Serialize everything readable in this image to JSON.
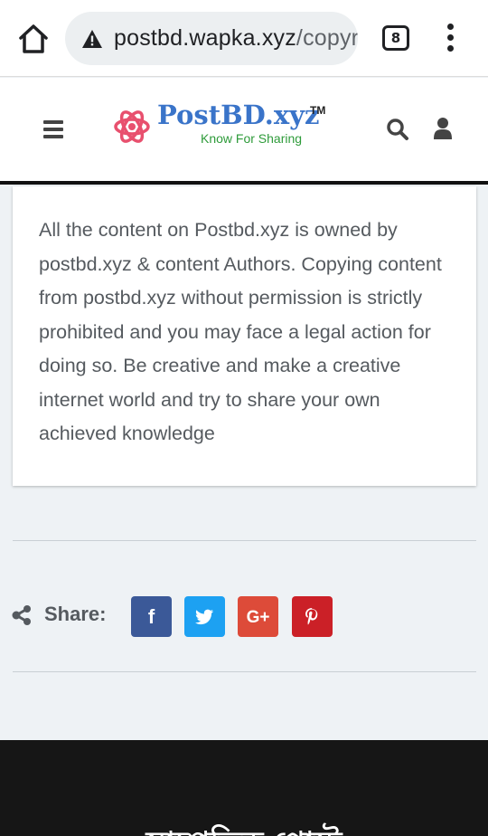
{
  "browser": {
    "url_host": "postbd.wapka.xyz",
    "url_path": "/copyr",
    "tab_count": "8"
  },
  "site": {
    "logo_title": "PostBD.xyz",
    "logo_tm": "TM",
    "tagline": "Know For Sharing"
  },
  "content": {
    "notice": "All the content on Postbd.xyz is owned by postbd.xyz & content Authors. Copying content from postbd.xyz without permission is strictly prohibited and you may face a legal action for doing so. Be creative and make a creative internet world and try to share your own achieved knowledge"
  },
  "share": {
    "label": "Share:",
    "buttons": [
      {
        "network": "facebook",
        "icon": "facebook-icon",
        "glyph": "f",
        "color": "#3b5998"
      },
      {
        "network": "twitter",
        "icon": "twitter-icon",
        "glyph": "",
        "color": "#1da1f2"
      },
      {
        "network": "google-plus",
        "icon": "google-plus-icon",
        "glyph": "G+",
        "color": "#dd4b39"
      },
      {
        "network": "pinterest",
        "icon": "pinterest-icon",
        "glyph": "P",
        "color": "#cb2027"
      }
    ]
  },
  "footer": {
    "heading": "সাম্প্রতিক পোস্ট"
  },
  "colors": {
    "brand_blue": "#3a74c9",
    "tagline_green": "#2e9b3a",
    "page_bg": "#eef2f5",
    "footer_bg": "#161616"
  }
}
